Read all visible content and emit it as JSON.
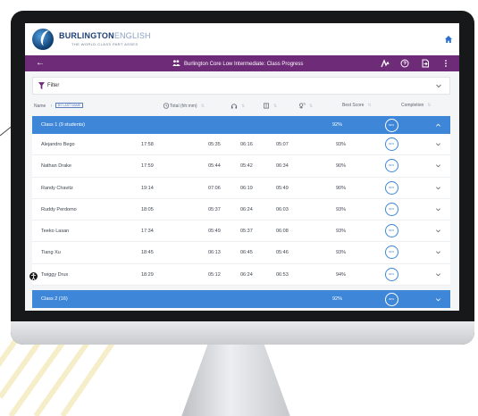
{
  "colors": {
    "brand_purple": "#6e2b78",
    "group_blue": "#3d86d8",
    "logo_navy": "#1d3f77"
  },
  "app": {
    "logo_strong": "BURLINGTON",
    "logo_light": "ENGLISH",
    "logo_tagline": "THE WORLD-CLASS PART ASSES",
    "title": "Burlington Core Low Intermediate: Class Progress",
    "icons": [
      "home-icon",
      "back-arrow-icon",
      "class-progress-icon",
      "signature-icon",
      "help-icon",
      "export-icon",
      "more-vert-icon"
    ]
  },
  "filter": {
    "label": "Filter"
  },
  "columns": {
    "name": "Name",
    "by_last_name": "BY LAST NAME",
    "total": "Total (hh:mm)",
    "best_score": "Best Score",
    "completion": "Completion"
  },
  "groups": [
    {
      "name": "Class 1 (9 students)",
      "score": "92%",
      "completion": "92%",
      "expanded": true,
      "rows": [
        {
          "name": "Alejandro Bego",
          "total": "17:58",
          "m1": "05:35",
          "m2": "06:16",
          "m3": "05:07",
          "score": "93%",
          "completion": "92%"
        },
        {
          "name": "Nathan Drake",
          "total": "17:59",
          "m1": "05:44",
          "m2": "05:42",
          "m3": "06:34",
          "score": "90%",
          "completion": "92%"
        },
        {
          "name": "Randy Chavitz",
          "total": "19:14",
          "m1": "07:06",
          "m2": "06:19",
          "m3": "05:49",
          "score": "90%",
          "completion": "92%"
        },
        {
          "name": "Ruddy Perdomo",
          "total": "18:05",
          "m1": "05:37",
          "m2": "06:24",
          "m3": "06:03",
          "score": "93%",
          "completion": "92%"
        },
        {
          "name": "Teeko Lasan",
          "total": "17:34",
          "m1": "05:49",
          "m2": "05:37",
          "m3": "06:08",
          "score": "93%",
          "completion": "92%"
        },
        {
          "name": "Tiang Xu",
          "total": "18:45",
          "m1": "06:13",
          "m2": "06:45",
          "m3": "05:46",
          "score": "93%",
          "completion": "92%"
        },
        {
          "name": "Twiggy Drux",
          "total": "18:29",
          "m1": "05:12",
          "m2": "06:24",
          "m3": "06:53",
          "score": "94%",
          "completion": "92%"
        }
      ]
    },
    {
      "name": "Class 2 (16)",
      "score": "92%",
      "completion": "92%",
      "expanded": false,
      "rows": []
    }
  ]
}
